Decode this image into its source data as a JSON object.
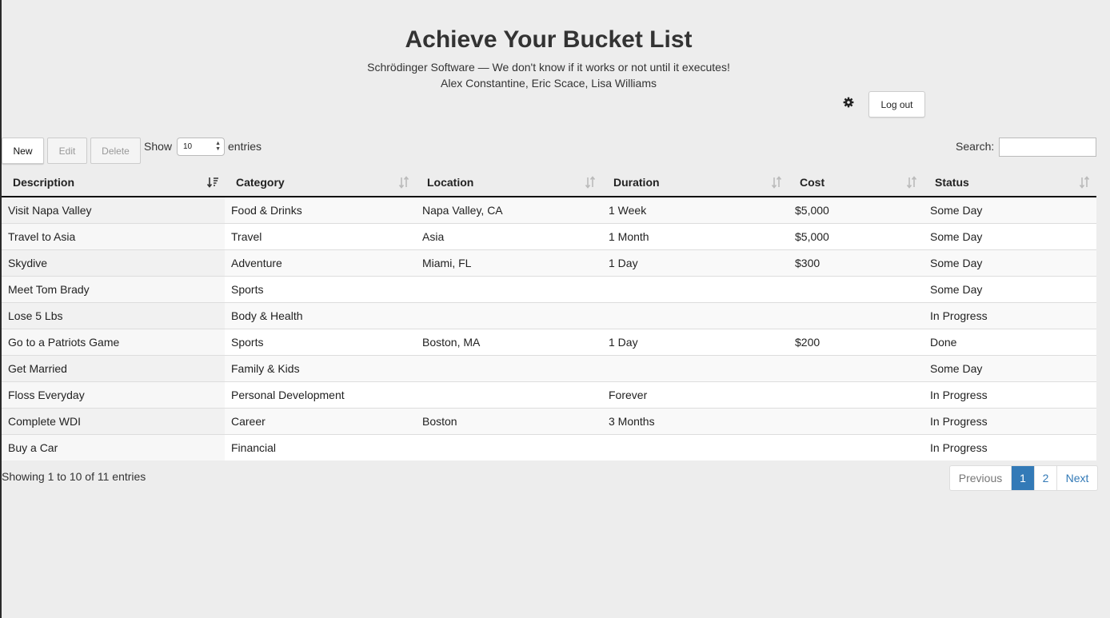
{
  "header": {
    "title": "Achieve Your Bucket List",
    "subtitle": "Schrödinger Software — We don't know if it works or not until it executes!",
    "authors": "Alex Constantine, Eric Scace, Lisa Williams"
  },
  "account": {
    "settings_icon": "gear-icon",
    "logout_label": "Log out"
  },
  "toolbar": {
    "new_label": "New",
    "edit_label": "Edit",
    "delete_label": "Delete"
  },
  "length": {
    "show_label": "Show",
    "value": "10",
    "entries_label": "entries"
  },
  "search": {
    "label": "Search:",
    "value": ""
  },
  "table": {
    "columns": [
      "Description",
      "Category",
      "Location",
      "Duration",
      "Cost",
      "Status"
    ],
    "rows": [
      [
        "Visit Napa Valley",
        "Food & Drinks",
        "Napa Valley, CA",
        "1 Week",
        "$5,000",
        "Some Day"
      ],
      [
        "Travel to Asia",
        "Travel",
        "Asia",
        "1 Month",
        "$5,000",
        "Some Day"
      ],
      [
        "Skydive",
        "Adventure",
        "Miami, FL",
        "1 Day",
        "$300",
        "Some Day"
      ],
      [
        "Meet Tom Brady",
        "Sports",
        "",
        "",
        "",
        "Some Day"
      ],
      [
        "Lose 5 Lbs",
        "Body & Health",
        "",
        "",
        "",
        "In Progress"
      ],
      [
        "Go to a Patriots Game",
        "Sports",
        "Boston, MA",
        "1 Day",
        "$200",
        "Done"
      ],
      [
        "Get Married",
        "Family & Kids",
        "",
        "",
        "",
        "Some Day"
      ],
      [
        "Floss Everyday",
        "Personal Development",
        "",
        "Forever",
        "",
        "In Progress"
      ],
      [
        "Complete WDI",
        "Career",
        "Boston",
        "3 Months",
        "",
        "In Progress"
      ],
      [
        "Buy a Car",
        "Financial",
        "",
        "",
        "",
        "In Progress"
      ]
    ]
  },
  "footer": {
    "info": "Showing 1 to 10 of 11 entries",
    "pagination": {
      "previous": "Previous",
      "pages": [
        "1",
        "2"
      ],
      "current": "1",
      "next": "Next"
    }
  },
  "colors": {
    "accent": "#337ab7",
    "background": "#ededed"
  }
}
